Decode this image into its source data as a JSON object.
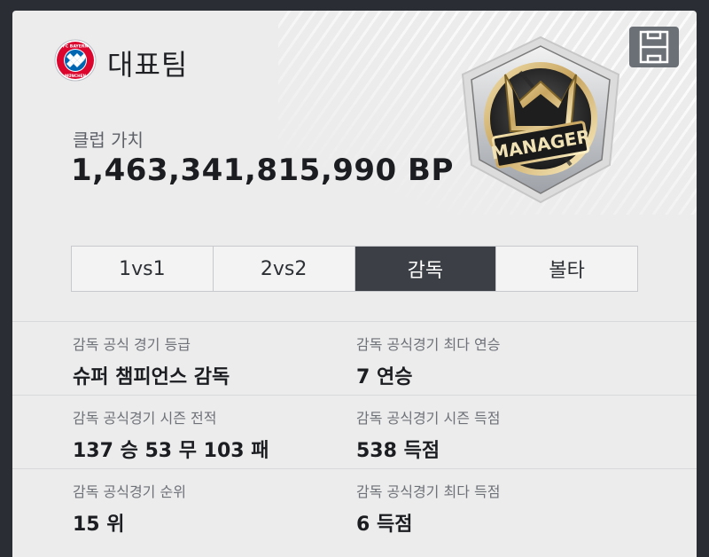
{
  "header": {
    "team_name": "대표팀",
    "club_value_label": "클럽 가치",
    "club_value": "1,463,341,815,990 BP",
    "logo": {
      "icon": "fc-bayern-munchen-logo",
      "text_top": "FC BAYERN",
      "text_bottom": "MÜNCHEN",
      "color": "#dc052d"
    },
    "badge": {
      "icon": "manager-crown-badge",
      "text": "MANAGER"
    },
    "pitch_button_icon": "pitch-formation-icon"
  },
  "tabs": [
    {
      "label": "1vs1",
      "active": false
    },
    {
      "label": "2vs2",
      "active": false
    },
    {
      "label": "감독",
      "active": true
    },
    {
      "label": "볼타",
      "active": false
    }
  ],
  "stats": [
    {
      "label": "감독 공식 경기 등급",
      "value": "슈퍼 챔피언스 감독"
    },
    {
      "label": "감독 공식경기 최다 연승",
      "value": "7 연승"
    },
    {
      "label": "감독 공식경기 시즌 전적",
      "value": "137 승 53 무 103 패"
    },
    {
      "label": "감독 공식경기 시즌 득점",
      "value": "538 득점"
    },
    {
      "label": "감독 공식경기 순위",
      "value": "15 위"
    },
    {
      "label": "감독 공식경기 최다 득점",
      "value": "6 득점"
    }
  ],
  "colors": {
    "card_bg": "#ececec",
    "active_tab": "#3c4046",
    "frame": "#2a2d33"
  }
}
